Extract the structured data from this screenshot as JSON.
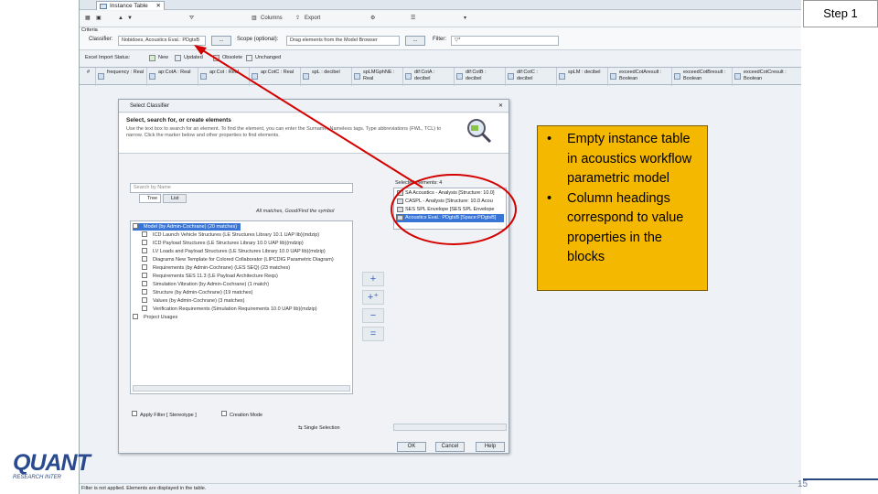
{
  "slide": {
    "step_label": "Step 1",
    "page_number": "15",
    "notes": [
      "Empty instance table in acoustics workflow parametric model",
      "Column headings correspond to value properties in the blocks"
    ]
  },
  "logo": {
    "text": "QUANT",
    "sub": "RESEARCH INTER"
  },
  "app": {
    "tab_title": "Instance Table",
    "toolbar": {
      "columns_label": "Columns",
      "export_label": "Export"
    },
    "criteria": {
      "section_label": "Criteria",
      "classifier_label": "Classifier:",
      "classifier_value": "Nobidoes, Acoustics Eval.: PDgtsB",
      "browse_label": "...",
      "scope_label": "Scope (optional):",
      "scope_value": "Drag elements from the Model Browser",
      "scope_browse": "...",
      "filter_label": "Filter:",
      "filter_value": "▽*"
    },
    "legend": {
      "label": "Excel Import Status:",
      "items": [
        "New",
        "Updated",
        "Obsolete",
        "Unchanged"
      ],
      "colors": [
        "#d8ecd0",
        "#e4ecf6",
        "#f8d4d4",
        "#eeeeee"
      ]
    },
    "columns": [
      "#",
      "frequency : Real",
      "ap:CotA : Real",
      "ap:Cot : Real",
      "ap:CotC : Real",
      "spL : decibel",
      "spLMGphNE : Real",
      "dif:CotA : decibel",
      "dif:CotB : decibel",
      "dif:CotC : decibel",
      "spLM : decibel",
      "exceedCotAresult : Boolean",
      "exceedCotBresult : Boolean",
      "exceedCotCresult : Boolean"
    ],
    "status_text": "Filter is not applied. Elements are displayed in the table."
  },
  "dialog": {
    "title": "Select Classifier",
    "header_title": "Select, search for, or create elements",
    "header_text": "Use the text box to search for an element. To find the element, you can enter the Surname, Nameless tags. Type abbreviations (FWL, TCL) to narrow. Click the marker below and other properties to find elements.",
    "search_placeholder": "Search by Name",
    "tabs": [
      "Tree",
      "List"
    ],
    "match_text": "All matches, Good/Find the symbol",
    "tree_items": [
      "Model (by Admin-Cochrane) (20 matches)",
      "ICD Launch Vehicle Structures (LE Structures Library 10.1 UAP lib)(mdzip)",
      "ICD Payload Structures (LE Structures Library 10.0 UAP lib)(mdzip)",
      "LV Loads and Payload Structures (LE Structures Library 10.0 UAP lib)(mdzip)",
      "Diagrams New Template for Colored Collaborator (LIPCDIG Parametric Diagram)",
      "Requirements (by Admin-Cochrane) (LES SEQ) (23 matches)",
      "Requirements SES 11.3 (LE Payload Architecture Reqs)",
      "Simulation Vibration (by Admin-Cochrane) (1 match)",
      "Structure (by Admin-Cochrane) (19 matches)",
      "Values (by Admin-Cochrane) (3 matches)",
      "Verification Requirements (Simulation Requirements 10.0 UAP lib)(mdzip)",
      "Project Usages"
    ],
    "selected_header": "Selected elements: 4",
    "selected_items": [
      "SA Acoustics - Analysis [Structure: 10.0]",
      "CASPL - Analysis [Structure: 10.0 Acou",
      "SES SPL Envelope [SES SPL Envelope",
      "Acoustics Eval.: PDgtsB [Space:PDgtsB]"
    ],
    "apply_filter_label": "Apply Filter [ Stereotype ]",
    "creation_mode_label": "Creation Mode",
    "single_selection_label": "Single Selection",
    "ok_label": "OK",
    "cancel_label": "Cancel",
    "help_label": "Help"
  }
}
